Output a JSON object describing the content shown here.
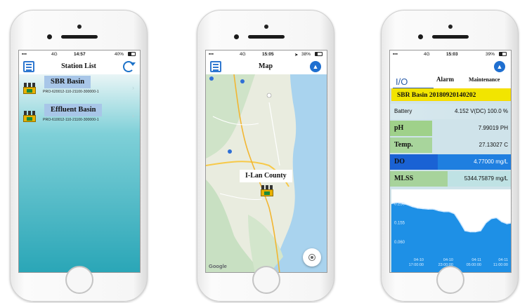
{
  "phones": [
    {
      "status": {
        "time": "14:57",
        "network": "4G",
        "battery_text": "40%",
        "battery_level": 0.4
      },
      "header": {
        "title": "Station List"
      },
      "stations": [
        {
          "name": "SBR Basin",
          "code": "PRO-620012-110-21100-300000-1"
        },
        {
          "name": "Effluent Basin",
          "code": "PRO-610012-110-21100-300000-1"
        }
      ]
    },
    {
      "status": {
        "time": "15:05",
        "network": "4G",
        "battery_text": "38%",
        "battery_level": 0.38
      },
      "header": {
        "title": "Map"
      },
      "map": {
        "county_label": "I-Lan County",
        "provider_logo": "Google"
      }
    },
    {
      "status": {
        "time": "15:03",
        "network": "4G",
        "battery_text": "39%",
        "battery_level": 0.39
      },
      "tabs": {
        "io": "I/O",
        "alarm": "Alarm",
        "maintenance": "Maintenance"
      },
      "station_banner": "SBR Basin 20180920140202",
      "readings": [
        {
          "label": "Battery",
          "value": "4.152 V(DC)  100.0 %"
        },
        {
          "label": "pH",
          "value": "7.99019  PH"
        },
        {
          "label": "Temp.",
          "value": "27.13027  C"
        },
        {
          "label": "DO",
          "value": "4.77000  mg/L"
        },
        {
          "label": "MLSS",
          "value": "5344.75879  mg/L"
        }
      ]
    }
  ],
  "colors": {
    "accent_blue": "#1d72c8",
    "banner_yellow": "#f2e500",
    "station_chip": "#a8c6e8",
    "teal_gradient_end": "#2aa6b7",
    "factory_yellow": "#e9b100"
  },
  "chart_data": {
    "type": "area",
    "title": "",
    "xlabel": "",
    "ylabel": "",
    "y_ticks": [
      "0.250",
      "0.155",
      "0.060"
    ],
    "x_ticks": [
      "04-10\n17:00:00",
      "04-10\n23:00:00",
      "04-11\n05:00:00",
      "04-11\n11:00:00"
    ],
    "ylim": [
      0.0,
      0.3
    ],
    "series": [
      {
        "values": [
          0.25,
          0.255,
          0.252,
          0.245,
          0.235,
          0.228,
          0.225,
          0.223,
          0.223,
          0.215,
          0.21,
          0.21,
          0.2,
          0.16,
          0.115,
          0.11,
          0.11,
          0.115,
          0.155,
          0.175,
          0.18,
          0.16,
          0.15,
          0.155
        ]
      }
    ],
    "grid": false,
    "fill_color": "#1e90e6"
  }
}
